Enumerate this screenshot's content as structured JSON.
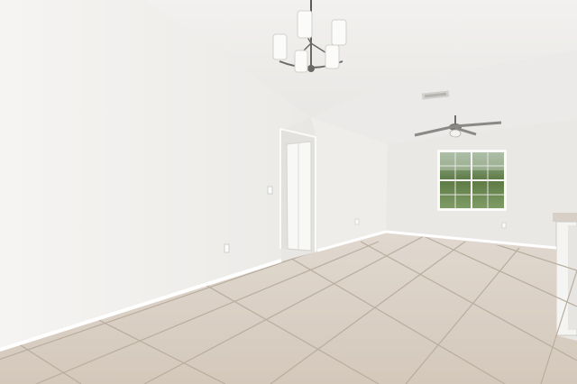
{
  "scene": {
    "subject": "empty-room-interior",
    "colors": {
      "ceiling": "#efeeec",
      "left_wall": "#f3f2f0",
      "back_wall": "#e8e6e3",
      "floor_tile": "#d6cbbf",
      "grout": "#b8ad9f",
      "baseboard": "#ffffff",
      "window_glass": "#5f7b4e",
      "door": "#f7f7f5"
    },
    "fixtures": {
      "chandelier_icon": "chandelier-icon",
      "ceiling_fan_icon": "ceiling-fan-icon",
      "vent_icon": "vent-icon",
      "outlet_icon": "outlet-icon"
    }
  }
}
